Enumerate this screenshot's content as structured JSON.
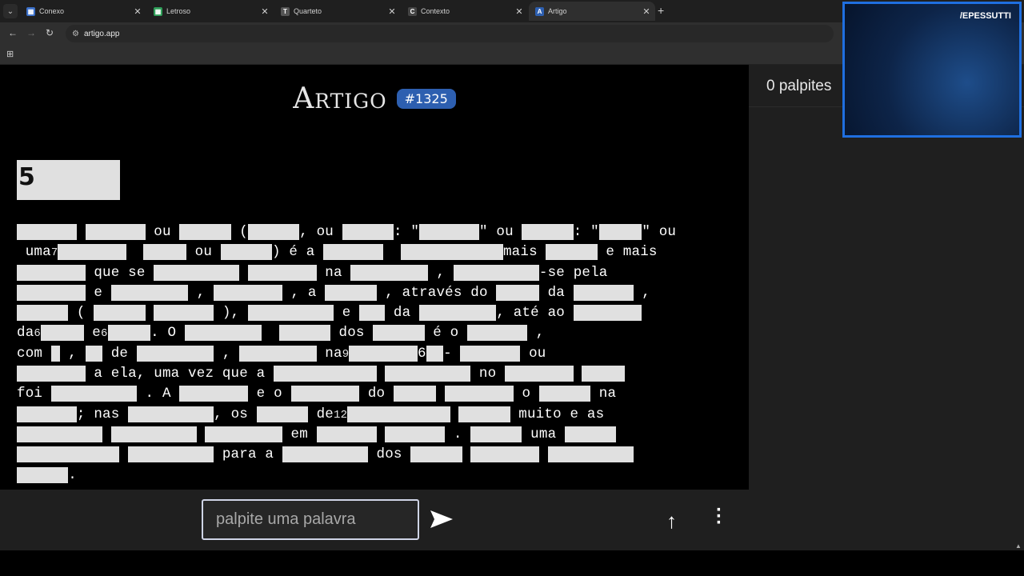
{
  "browser": {
    "tabs": [
      {
        "label": "Conexo",
        "fav": "▦",
        "color": "#3a6fc9"
      },
      {
        "label": "Letroso",
        "fav": "▦",
        "color": "#2e9e58"
      },
      {
        "label": "Quarteto",
        "fav": "T",
        "color": "#555555"
      },
      {
        "label": "Contexto",
        "fav": "C",
        "color": "#444444"
      },
      {
        "label": "Artigo",
        "fav": "A",
        "color": "#2d5fb0"
      }
    ],
    "url": "artigo.app"
  },
  "game": {
    "title": "Artigo",
    "number": "#1325",
    "heading": "5"
  },
  "paragraph": [
    [
      [
        "b",
        "       "
      ],
      [
        " "
      ],
      [
        "b",
        "       "
      ],
      [
        " ou "
      ],
      [
        "b",
        "      "
      ],
      [
        " ("
      ],
      [
        "b",
        "      "
      ],
      [
        ", ou "
      ],
      [
        "b",
        "      "
      ],
      [
        ": \""
      ],
      [
        "b",
        "       "
      ],
      [
        "\" ou "
      ],
      [
        "b",
        "      "
      ],
      [
        ": \""
      ],
      [
        "b",
        "     "
      ],
      [
        "\" ou"
      ]
    ],
    [
      [
        " uma"
      ],
      [
        "n",
        "7"
      ],
      [
        "b",
        "        "
      ],
      [
        "  "
      ],
      [
        "b",
        "     "
      ],
      [
        " ou "
      ],
      [
        "b",
        "      "
      ],
      [
        ") é a "
      ],
      [
        "b",
        "       "
      ],
      [
        "  "
      ],
      [
        "b",
        "            "
      ],
      [
        "mais "
      ],
      [
        "b",
        "      "
      ],
      [
        " e mais"
      ]
    ],
    [
      [
        "b",
        "        "
      ],
      [
        " que se "
      ],
      [
        "b",
        "          "
      ],
      [
        " "
      ],
      [
        "b",
        "        "
      ],
      [
        " na "
      ],
      [
        "b",
        "         "
      ],
      [
        " , "
      ],
      [
        "b",
        "          "
      ],
      [
        "-se pela"
      ]
    ],
    [
      [
        "b",
        "        "
      ],
      [
        " e "
      ],
      [
        "b",
        "         "
      ],
      [
        " , "
      ],
      [
        "b",
        "        "
      ],
      [
        " , a "
      ],
      [
        "b",
        "      "
      ],
      [
        " , através do "
      ],
      [
        "b",
        "     "
      ],
      [
        " da "
      ],
      [
        "b",
        "       "
      ],
      [
        " ,"
      ]
    ],
    [
      [
        "b",
        "      "
      ],
      [
        " ( "
      ],
      [
        "b",
        "      "
      ],
      [
        " "
      ],
      [
        "b",
        "       "
      ],
      [
        " ), "
      ],
      [
        "b",
        "          "
      ],
      [
        " e "
      ],
      [
        "b",
        "   "
      ],
      [
        " da "
      ],
      [
        "b",
        "         "
      ],
      [
        ", até ao "
      ],
      [
        "b",
        "        "
      ]
    ],
    [
      [
        "da"
      ],
      [
        "n",
        "6"
      ],
      [
        "b",
        "     "
      ],
      [
        " e"
      ],
      [
        "n",
        "6"
      ],
      [
        "b",
        "     "
      ],
      [
        ". O "
      ],
      [
        "b",
        "         "
      ],
      [
        "  "
      ],
      [
        "b",
        "      "
      ],
      [
        " dos "
      ],
      [
        "b",
        "      "
      ],
      [
        " é o "
      ],
      [
        "b",
        "       "
      ],
      [
        " ,"
      ]
    ],
    [
      [
        "com "
      ],
      [
        "b",
        " "
      ],
      [
        " , "
      ],
      [
        "b",
        "  "
      ],
      [
        " de "
      ],
      [
        "b",
        "         "
      ],
      [
        " , "
      ],
      [
        "b",
        "         "
      ],
      [
        " na"
      ],
      [
        "n",
        "9"
      ],
      [
        "b",
        "        "
      ],
      [
        "6"
      ],
      [
        "b",
        "  "
      ],
      [
        "- "
      ],
      [
        "b",
        "       "
      ],
      [
        " ou"
      ]
    ],
    [
      [
        "b",
        "        "
      ],
      [
        " a ela, uma vez que a "
      ],
      [
        "b",
        "            "
      ],
      [
        " "
      ],
      [
        "b",
        "          "
      ],
      [
        " no "
      ],
      [
        "b",
        "        "
      ],
      [
        " "
      ],
      [
        "b",
        "     "
      ]
    ],
    [
      [
        "foi "
      ],
      [
        "b",
        "          "
      ],
      [
        " . A "
      ],
      [
        "b",
        "        "
      ],
      [
        " e o "
      ],
      [
        "b",
        "        "
      ],
      [
        " do "
      ],
      [
        "b",
        "     "
      ],
      [
        " "
      ],
      [
        "b",
        "        "
      ],
      [
        " o "
      ],
      [
        "b",
        "      "
      ],
      [
        " na"
      ]
    ],
    [
      [
        "b",
        "       "
      ],
      [
        "; nas "
      ],
      [
        "b",
        "          "
      ],
      [
        ", os "
      ],
      [
        "b",
        "      "
      ],
      [
        " de"
      ],
      [
        "n",
        "12"
      ],
      [
        "b",
        "            "
      ],
      [
        " "
      ],
      [
        "b",
        "      "
      ],
      [
        " muito e as"
      ]
    ],
    [
      [
        "b",
        "          "
      ],
      [
        " "
      ],
      [
        "b",
        "          "
      ],
      [
        " "
      ],
      [
        "b",
        "         "
      ],
      [
        " em "
      ],
      [
        "b",
        "       "
      ],
      [
        " "
      ],
      [
        "b",
        "       "
      ],
      [
        " . "
      ],
      [
        "b",
        "      "
      ],
      [
        " uma "
      ],
      [
        "b",
        "      "
      ]
    ],
    [
      [
        "b",
        "            "
      ],
      [
        " "
      ],
      [
        "b",
        "          "
      ],
      [
        " para a "
      ],
      [
        "b",
        "          "
      ],
      [
        " dos "
      ],
      [
        "b",
        "      "
      ],
      [
        " "
      ],
      [
        "b",
        "        "
      ],
      [
        " "
      ],
      [
        "b",
        "          "
      ]
    ],
    [
      [
        "b",
        "      "
      ],
      [
        "."
      ]
    ]
  ],
  "bottom": {
    "placeholder": "palpite uma palavra"
  },
  "sidebar": {
    "count_text": "0 palpites"
  },
  "webcam": {
    "name": "/EPESSUTTI"
  },
  "colors": {
    "accent": "#2d5fb0",
    "redacted": "#e0e0e0",
    "cam_border": "#1f6fe0"
  }
}
